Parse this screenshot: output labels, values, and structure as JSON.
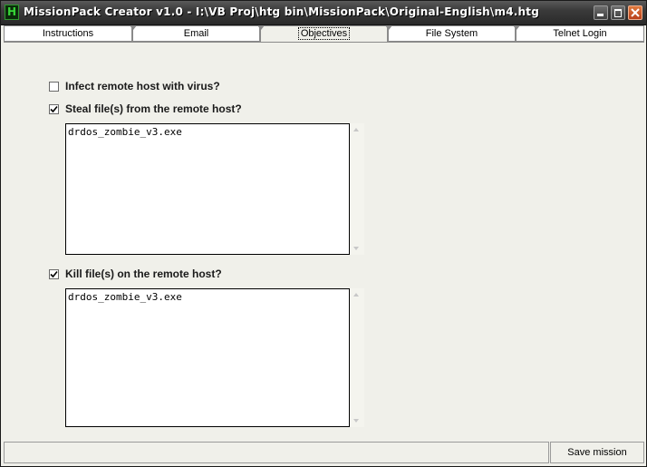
{
  "window": {
    "title": "MissionPack Creator v1.0 - I:\\VB Proj\\htg bin\\MissionPack\\Original-English\\m4.htg",
    "icon_letter": "H"
  },
  "tabs": [
    {
      "label": "Instructions",
      "active": false
    },
    {
      "label": "Email",
      "active": false
    },
    {
      "label": "Objectives",
      "active": true
    },
    {
      "label": "File System",
      "active": false
    },
    {
      "label": "Telnet Login",
      "active": false
    }
  ],
  "objectives": {
    "infect": {
      "label": "Infect remote host with virus?",
      "checked": false
    },
    "steal": {
      "label": "Steal file(s) from the remote host?",
      "checked": true,
      "files": "drdos_zombie_v3.exe"
    },
    "kill": {
      "label": "Kill file(s) on the remote host?",
      "checked": true,
      "files": "drdos_zombie_v3.exe"
    }
  },
  "statusbar": {
    "status_text": "",
    "save_label": "Save mission"
  },
  "icons": {
    "app": "app-icon",
    "minimize": "minimize-icon",
    "maximize": "maximize-icon",
    "close": "close-icon",
    "check": "checkmark-icon"
  }
}
